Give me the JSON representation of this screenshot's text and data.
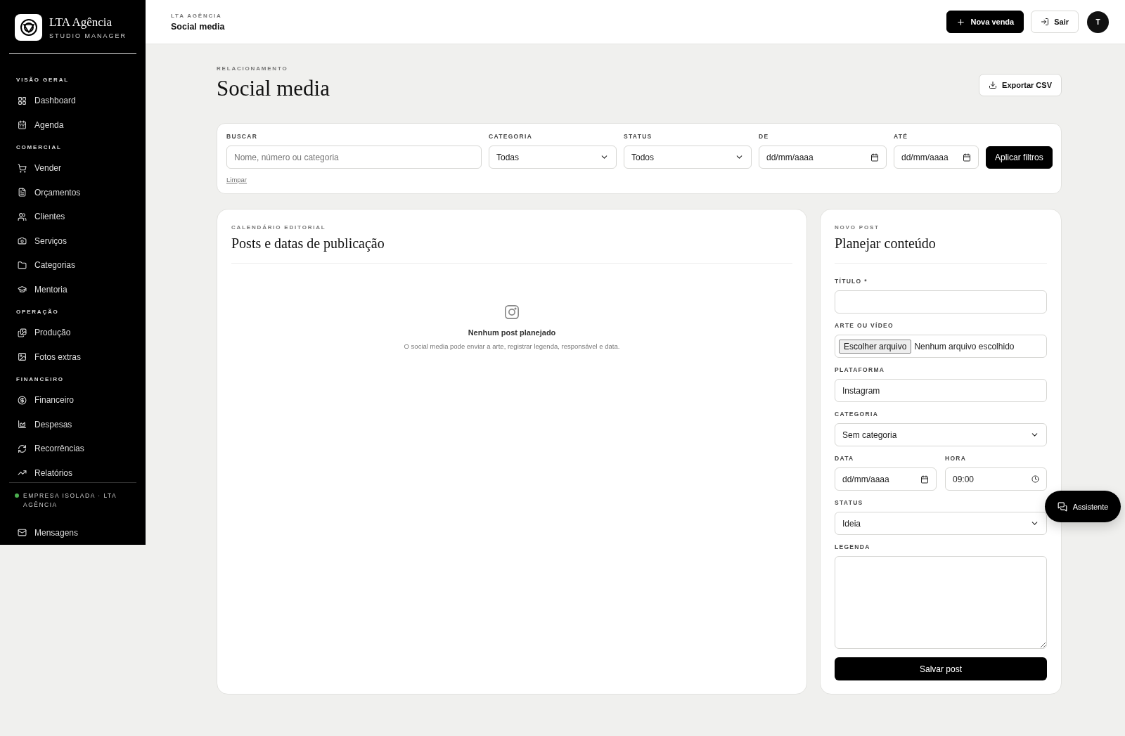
{
  "sidebar": {
    "brand": {
      "name": "LTA Agência",
      "tagline": "STUDIO MANAGER"
    },
    "sections": [
      {
        "title": "VISÃO GERAL",
        "items": [
          {
            "label": "Dashboard"
          },
          {
            "label": "Agenda"
          }
        ]
      },
      {
        "title": "COMERCIAL",
        "items": [
          {
            "label": "Vender"
          },
          {
            "label": "Orçamentos"
          },
          {
            "label": "Clientes"
          },
          {
            "label": "Serviços"
          },
          {
            "label": "Categorias"
          },
          {
            "label": "Mentoria"
          }
        ]
      },
      {
        "title": "OPERAÇÃO",
        "items": [
          {
            "label": "Produção"
          },
          {
            "label": "Fotos extras"
          }
        ]
      },
      {
        "title": "FINANCEIRO",
        "items": [
          {
            "label": "Financeiro"
          },
          {
            "label": "Despesas"
          },
          {
            "label": "Recorrências"
          },
          {
            "label": "Relatórios"
          }
        ]
      }
    ],
    "footer": "EMPRESA ISOLADA · LTA AGÊNCIA",
    "after_footer": [
      {
        "label": "Mensagens"
      }
    ]
  },
  "header": {
    "eyebrow": "LTA AGÊNCIA",
    "title": "Social media",
    "buttons": [
      {
        "kind": "primary",
        "label": "Nova venda"
      },
      {
        "kind": "outline",
        "label": "Sair"
      }
    ],
    "avatar": "T"
  },
  "page": {
    "eyebrow": "RELACIONAMENTO",
    "title": "Social media",
    "export": "Exportar CSV"
  },
  "filters": {
    "fields": [
      {
        "kind": "search",
        "label": "BUSCAR",
        "placeholder": "Nome, número ou categoria"
      },
      {
        "kind": "select",
        "label": "CATEGORIA",
        "value": "Todas"
      },
      {
        "kind": "select",
        "label": "STATUS",
        "value": "Todos"
      },
      {
        "kind": "date",
        "label": "DE",
        "placeholder": "dd/mm/aaaa"
      },
      {
        "kind": "date",
        "label": "ATÉ",
        "placeholder": "dd/mm/aaaa"
      }
    ],
    "apply": "Aplicar filtros",
    "clear": "Limpar"
  },
  "calendar": {
    "eyebrow": "CALENDÁRIO EDITORIAL",
    "title": "Posts e datas de publicação",
    "empty": {
      "title": "Nenhum post planejado",
      "text": "O social media pode enviar a arte, registrar legenda, responsável e data."
    }
  },
  "form": {
    "eyebrow": "NOVO POST",
    "title": "Planejar conteúdo",
    "fields": [
      {
        "kind": "text",
        "label": "TÍTULO *"
      },
      {
        "kind": "file",
        "label": "ARTE OU VÍDEO",
        "button": "Escolher arquivo",
        "value": "Nenhum arquivo escolhido"
      },
      {
        "kind": "text",
        "label": "PLATAFORMA",
        "value": "Instagram"
      },
      {
        "kind": "select",
        "label": "CATEGORIA",
        "value": "Sem categoria"
      },
      {
        "kind": "pair",
        "fields": [
          {
            "kind": "date",
            "label": "DATA",
            "placeholder": "dd/mm/aaaa"
          },
          {
            "kind": "time",
            "label": "HORA",
            "value": "09:00"
          }
        ]
      },
      {
        "kind": "select",
        "label": "STATUS",
        "value": "Ideia"
      },
      {
        "kind": "textarea",
        "label": "LEGENDA"
      }
    ],
    "submit": "Salvar post"
  },
  "assistant": "Assistente"
}
